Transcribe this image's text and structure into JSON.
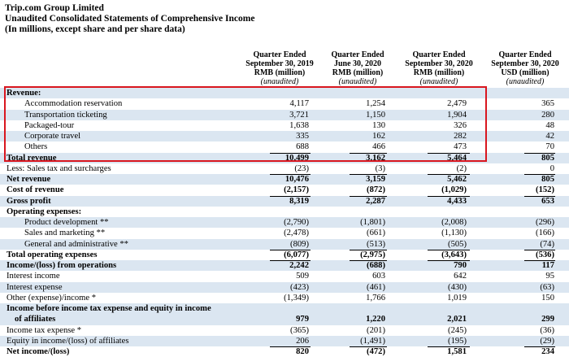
{
  "header": {
    "company": "Trip.com Group Limited",
    "statement_title": "Unaudited Consolidated Statements of Comprehensive Income",
    "units_note": "(In millions, except share and per share data)"
  },
  "columns": [
    {
      "line1": "Quarter Ended",
      "line2": "September 30, 2019",
      "line3": "RMB (million)",
      "line4": "(unaudited)"
    },
    {
      "line1": "Quarter Ended",
      "line2": "June 30, 2020",
      "line3": "RMB (million)",
      "line4": "(unaudited)"
    },
    {
      "line1": "Quarter Ended",
      "line2": "September 30, 2020",
      "line3": "RMB (million)",
      "line4": "(unaudited)"
    },
    {
      "line1": "Quarter Ended",
      "line2": "September 30, 2020",
      "line3": "USD (million)",
      "line4": "(unaudited)"
    }
  ],
  "rows": [
    {
      "label": "Revenue:",
      "values": [
        "",
        "",
        "",
        ""
      ]
    },
    {
      "label": "Accommodation reservation",
      "values": [
        "4,117",
        "1,254",
        "2,479",
        "365"
      ]
    },
    {
      "label": "Transportation ticketing",
      "values": [
        "3,721",
        "1,150",
        "1,904",
        "280"
      ]
    },
    {
      "label": "Packaged-tour",
      "values": [
        "1,638",
        "130",
        "326",
        "48"
      ]
    },
    {
      "label": "Corporate travel",
      "values": [
        "335",
        "162",
        "282",
        "42"
      ]
    },
    {
      "label": "Others",
      "values": [
        "688",
        "466",
        "473",
        "70"
      ]
    },
    {
      "label": "Total revenue",
      "values": [
        "10,499",
        "3,162",
        "5,464",
        "805"
      ]
    },
    {
      "label": "Less: Sales tax and surcharges",
      "values": [
        "(23)",
        "(3)",
        "(2)",
        "0"
      ]
    },
    {
      "label": "Net revenue",
      "values": [
        "10,476",
        "3,159",
        "5,462",
        "805"
      ]
    },
    {
      "label": "Cost of revenue",
      "values": [
        "(2,157)",
        "(872)",
        "(1,029)",
        "(152)"
      ]
    },
    {
      "label": "Gross profit",
      "values": [
        "8,319",
        "2,287",
        "4,433",
        "653"
      ]
    },
    {
      "label": "Operating expenses:",
      "values": [
        "",
        "",
        "",
        ""
      ]
    },
    {
      "label": "Product development **",
      "values": [
        "(2,790)",
        "(1,801)",
        "(2,008)",
        "(296)"
      ]
    },
    {
      "label": "Sales and marketing **",
      "values": [
        "(2,478)",
        "(661)",
        "(1,130)",
        "(166)"
      ]
    },
    {
      "label": "General and administrative **",
      "values": [
        "(809)",
        "(513)",
        "(505)",
        "(74)"
      ]
    },
    {
      "label": "Total operating expenses",
      "values": [
        "(6,077)",
        "(2,975)",
        "(3,643)",
        "(536)"
      ]
    },
    {
      "label": "Income/(loss) from operations",
      "values": [
        "2,242",
        "(688)",
        "790",
        "117"
      ]
    },
    {
      "label": "Interest income",
      "values": [
        "509",
        "603",
        "642",
        "95"
      ]
    },
    {
      "label": "Interest expense",
      "values": [
        "(423)",
        "(461)",
        "(430)",
        "(63)"
      ]
    },
    {
      "label": "Other (expense)/income *",
      "values": [
        "(1,349)",
        "1,766",
        "1,019",
        "150"
      ]
    },
    {
      "label": "Income before income tax expense and equity in income",
      "values": [
        "",
        "",
        "",
        ""
      ]
    },
    {
      "label": "of affiliates",
      "values": [
        "979",
        "1,220",
        "2,021",
        "299"
      ]
    },
    {
      "label": "Income tax expense *",
      "values": [
        "(365)",
        "(201)",
        "(245)",
        "(36)"
      ]
    },
    {
      "label": "Equity in income/(loss) of affiliates",
      "values": [
        "206",
        "(1,491)",
        "(195)",
        "(29)"
      ]
    },
    {
      "label": "Net income/(loss)",
      "values": [
        "820",
        "(472)",
        "1,581",
        "234"
      ]
    }
  ]
}
